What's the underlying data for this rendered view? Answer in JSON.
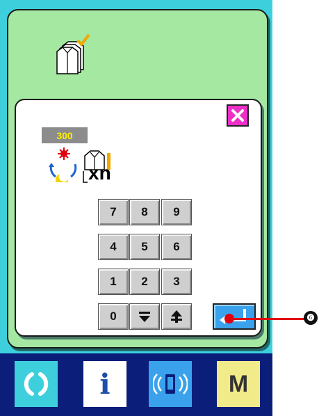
{
  "colors": {
    "screen_bg": "#3dd0dc",
    "panel_bg": "#a4e8a2",
    "dialog_bg": "#ffffff",
    "close_button": "#ee2ec8",
    "counter_bg": "#8c8c8c",
    "counter_text": "#ffee00",
    "enter_key": "#3aa2ec",
    "bottom_bar": "#0b1e7a",
    "marker": "#e00010"
  },
  "header": {
    "icon": "shirt-stack-check-icon"
  },
  "dialog": {
    "close_icon": "close-icon",
    "counter_value": "300",
    "cycle_icon": "cycle-icon",
    "multiplier_icon": "shirt-multiplier-icon",
    "multiplier_label": "xn",
    "keys": {
      "k7": "7",
      "k8": "8",
      "k9": "9",
      "k4": "4",
      "k5": "5",
      "k6": "6",
      "k1": "1",
      "k2": "2",
      "k3": "3",
      "k0": "0"
    },
    "down_icon": "decrement-icon",
    "up_icon": "increment-icon",
    "enter_icon": "enter-icon"
  },
  "callout": {
    "label": "❻"
  },
  "bottom_bar": {
    "buttons": [
      {
        "icon": "ready-icon"
      },
      {
        "icon": "info-icon",
        "label": "i"
      },
      {
        "icon": "communication-icon"
      },
      {
        "icon": "mode-icon",
        "label": "M"
      }
    ]
  }
}
